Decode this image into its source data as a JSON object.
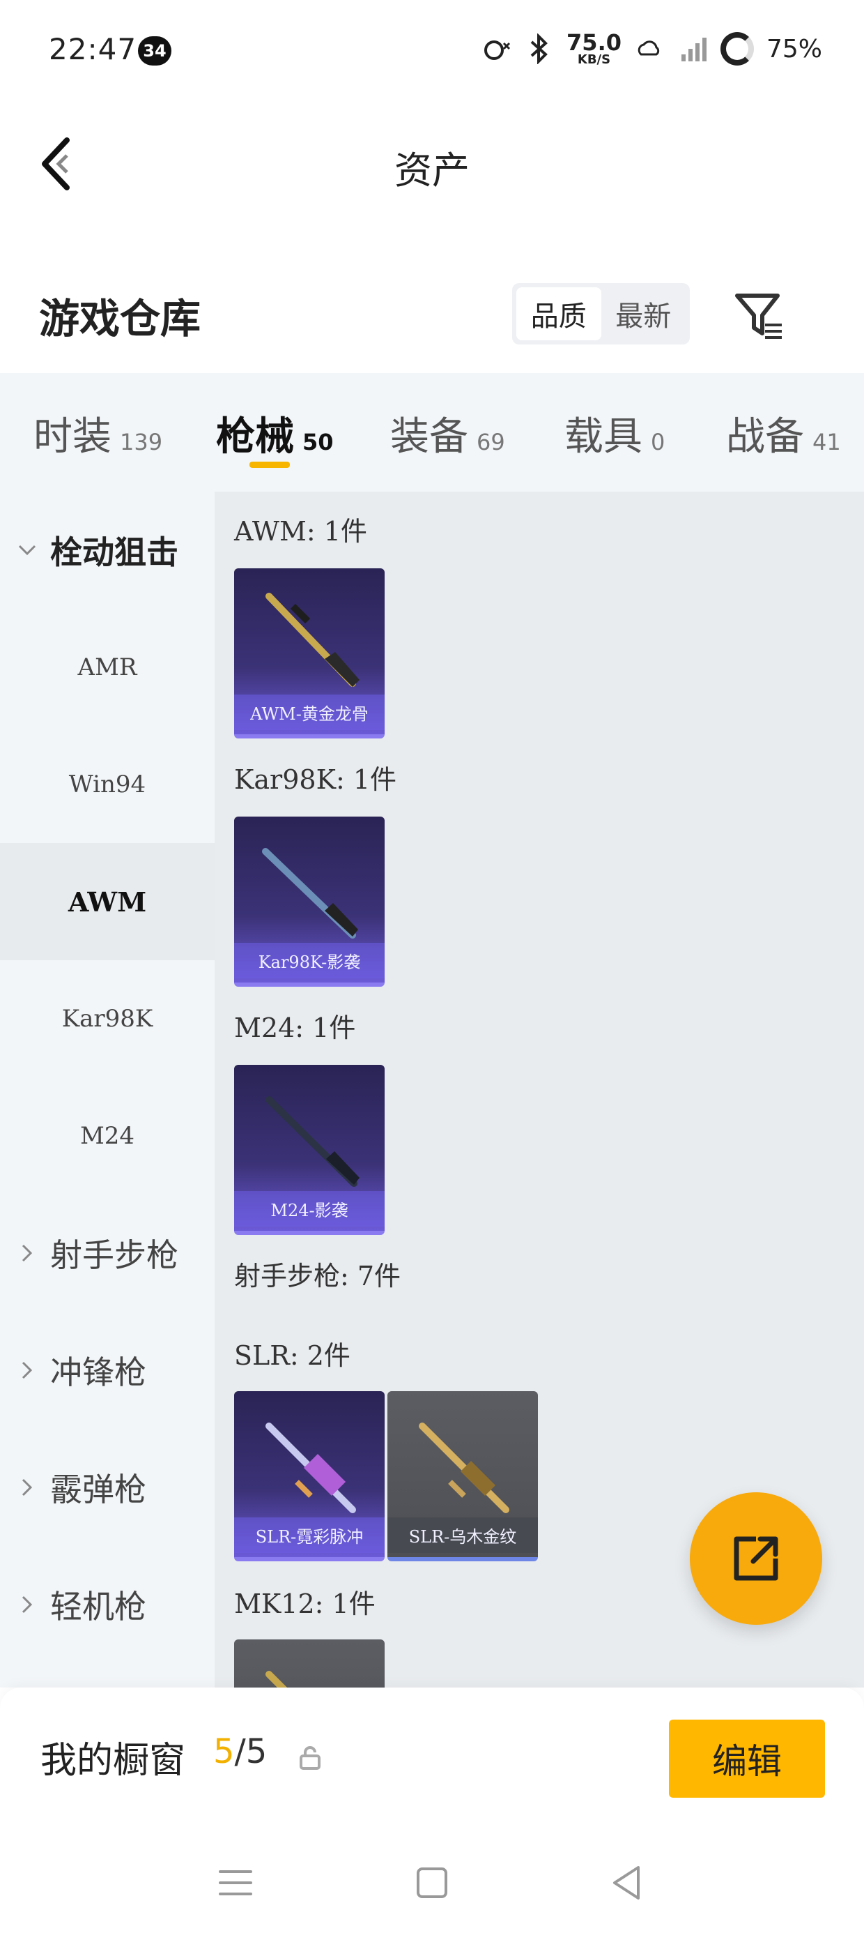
{
  "status_bar": {
    "time": "22:47",
    "badge": "34",
    "net_speed": "75.0",
    "net_unit": "KB/S",
    "battery": "75%"
  },
  "header": {
    "title": "资产"
  },
  "warehouse": {
    "title": "游戏仓库",
    "sort_options": [
      "品质",
      "最新"
    ],
    "active_sort": "品质"
  },
  "tabs": [
    {
      "label": "时装",
      "count": "139"
    },
    {
      "label": "枪械",
      "count": "50"
    },
    {
      "label": "装备",
      "count": "69"
    },
    {
      "label": "载具",
      "count": "0"
    },
    {
      "label": "战备",
      "count": "41"
    }
  ],
  "active_tab": "枪械",
  "sidebar": {
    "open_group": "栓动狙击",
    "sub_items": [
      "AMR",
      "Win94",
      "AWM",
      "Kar98K",
      "M24"
    ],
    "active_sub": "AWM",
    "groups": [
      "射手步枪",
      "冲锋枪",
      "霰弹枪",
      "轻机枪"
    ]
  },
  "content": {
    "sections": [
      {
        "label": "AWM: 1件",
        "cards": [
          "AWM-黄金龙骨"
        ]
      },
      {
        "label": "Kar98K: 1件",
        "cards": [
          "Kar98K-影袭"
        ]
      },
      {
        "label": "M24: 1件",
        "cards": [
          "M24-影袭"
        ]
      },
      {
        "label": "射手步枪: 7件"
      },
      {
        "label": "SLR: 2件",
        "cards": [
          "SLR-霓彩脉冲",
          "SLR-乌木金纹"
        ]
      },
      {
        "label": "MK12: 1件"
      }
    ]
  },
  "showcase": {
    "title": "我的橱窗",
    "current": "5",
    "total": "/5",
    "edit_label": "编辑"
  },
  "icons": {
    "back": "chevron-left-icon",
    "filter": "filter-icon",
    "fab": "share-out-icon",
    "lock": "lock-icon"
  },
  "colors": {
    "accent": "#ffb700",
    "fab": "#f8a90b",
    "tab_underline": "#f7b500"
  }
}
